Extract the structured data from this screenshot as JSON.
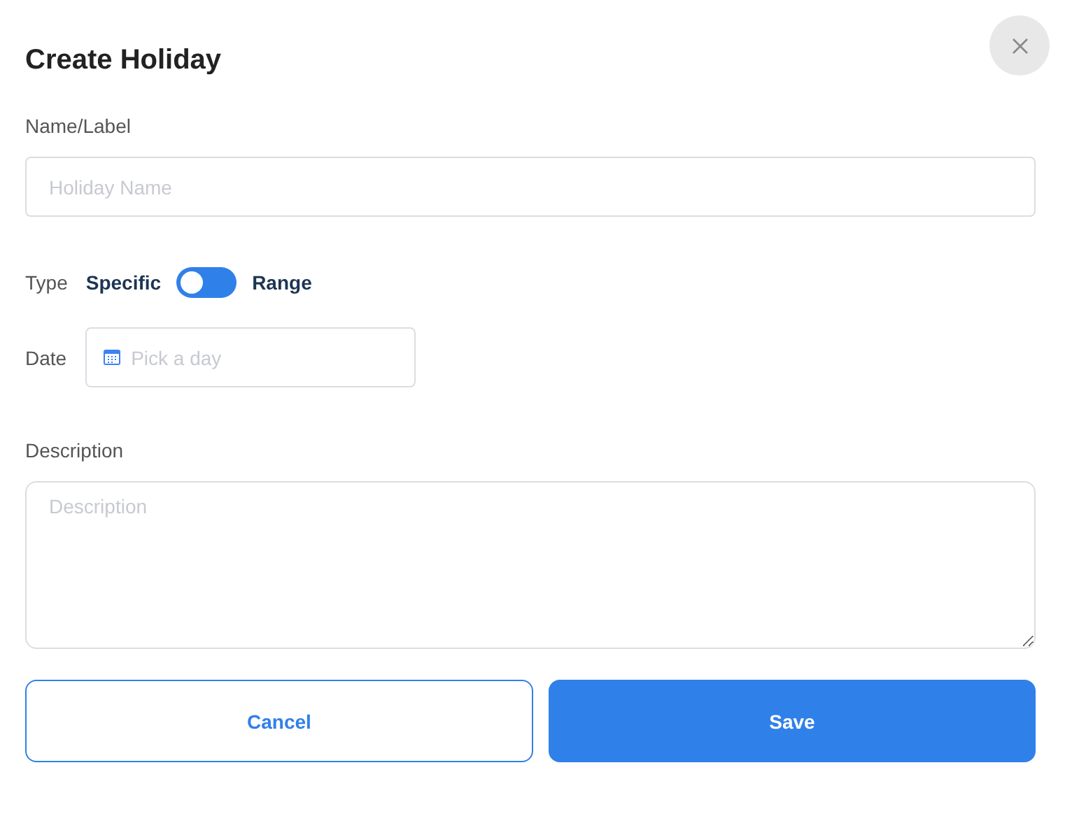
{
  "dialog": {
    "title": "Create Holiday"
  },
  "name_field": {
    "label": "Name/Label",
    "placeholder": "Holiday Name"
  },
  "type_toggle": {
    "label": "Type",
    "left_label": "Specific",
    "right_label": "Range",
    "on": false
  },
  "date_field": {
    "label": "Date",
    "placeholder": "Pick a day"
  },
  "description_field": {
    "label": "Description",
    "placeholder": "Description"
  },
  "buttons": [
    {
      "label": "Cancel",
      "kind": "secondary"
    },
    {
      "label": "Save",
      "kind": "primary"
    }
  ]
}
